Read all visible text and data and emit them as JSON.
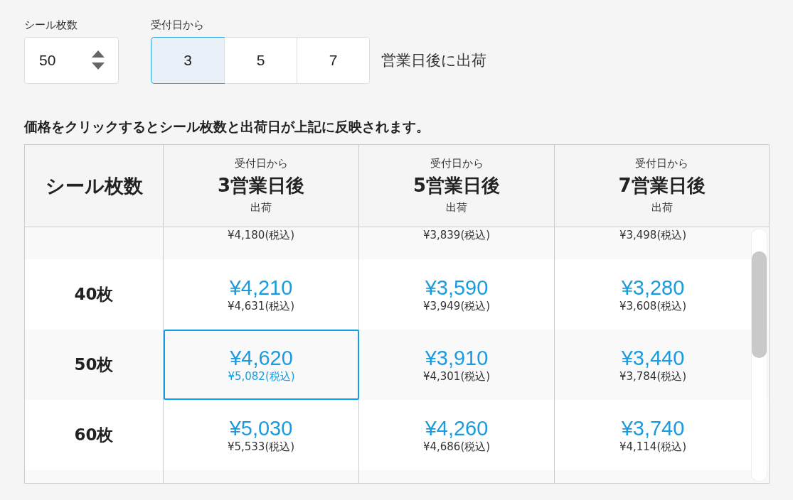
{
  "quantity": {
    "label": "シール枚数",
    "value": "50"
  },
  "shipping": {
    "label": "受付日から",
    "options": [
      {
        "label": "3",
        "selected": true
      },
      {
        "label": "5",
        "selected": false
      },
      {
        "label": "7",
        "selected": false
      }
    ],
    "suffix": "営業日後に出荷"
  },
  "caption": "価格をクリックするとシール枚数と出荷日が上記に反映されます。",
  "table": {
    "corner": "シール枚数",
    "columns": [
      {
        "top": "受付日から",
        "main": "3営業日後",
        "bottom": "出荷"
      },
      {
        "top": "受付日から",
        "main": "5営業日後",
        "bottom": "出荷"
      },
      {
        "top": "受付日から",
        "main": "7営業日後",
        "bottom": "出荷"
      }
    ],
    "rows": [
      {
        "kind": "partial",
        "cells": [
          {
            "tax": "¥4,180(税込)",
            "selected": false
          },
          {
            "tax": "¥3,839(税込)",
            "selected": false
          },
          {
            "tax": "¥3,498(税込)",
            "selected": false
          }
        ]
      },
      {
        "kind": "full",
        "label": "40枚",
        "cells": [
          {
            "price": "¥4,210",
            "tax": "¥4,631(税込)",
            "selected": false
          },
          {
            "price": "¥3,590",
            "tax": "¥3,949(税込)",
            "selected": false
          },
          {
            "price": "¥3,280",
            "tax": "¥3,608(税込)",
            "selected": false
          }
        ]
      },
      {
        "kind": "full",
        "label": "50枚",
        "cells": [
          {
            "price": "¥4,620",
            "tax": "¥5,082(税込)",
            "selected": true
          },
          {
            "price": "¥3,910",
            "tax": "¥4,301(税込)",
            "selected": false
          },
          {
            "price": "¥3,440",
            "tax": "¥3,784(税込)",
            "selected": false
          }
        ]
      },
      {
        "kind": "full",
        "label": "60枚",
        "cells": [
          {
            "price": "¥5,030",
            "tax": "¥5,533(税込)",
            "selected": false
          },
          {
            "price": "¥4,260",
            "tax": "¥4,686(税込)",
            "selected": false
          },
          {
            "price": "¥3,740",
            "tax": "¥4,114(税込)",
            "selected": false
          }
        ]
      },
      {
        "kind": "empty"
      }
    ]
  }
}
